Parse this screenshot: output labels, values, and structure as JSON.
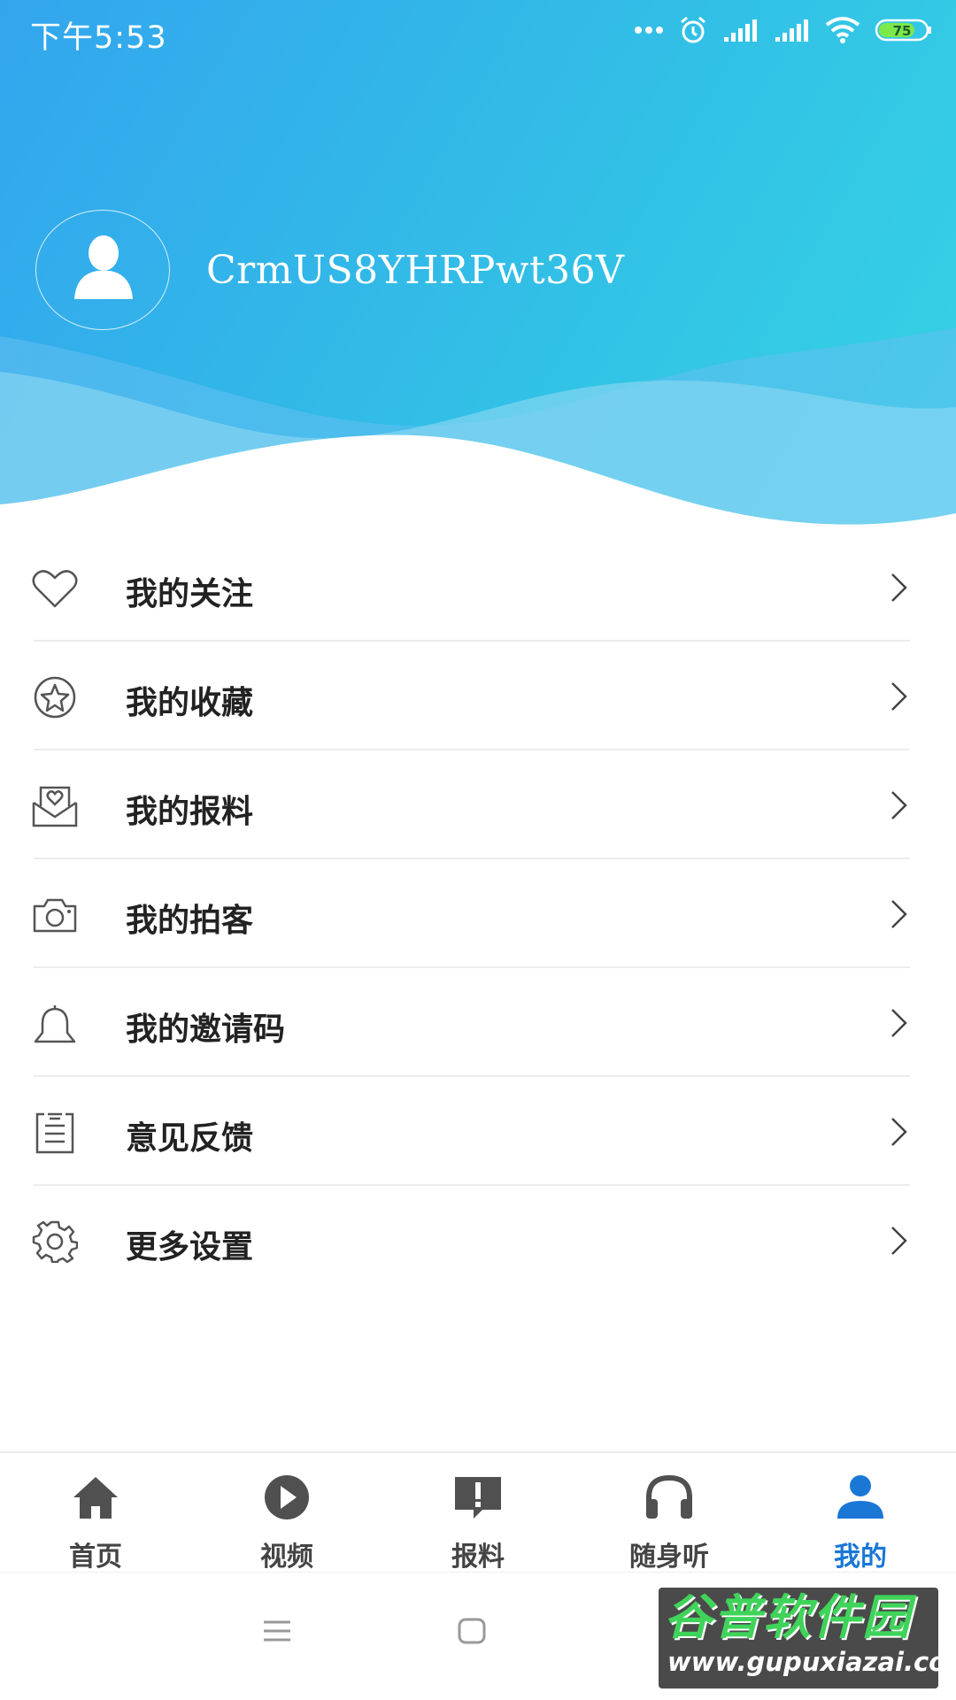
{
  "status_bar": {
    "time": "下午5:53",
    "battery": "75",
    "icons": [
      "more-dots-icon",
      "alarm-icon",
      "signal-icon",
      "signal-icon",
      "wifi-icon",
      "battery-icon"
    ]
  },
  "profile": {
    "username": "CrmUS8YHRPwt36V",
    "avatar_icon": "person-icon"
  },
  "menu": [
    {
      "label": "我的关注",
      "icon": "heart-icon"
    },
    {
      "label": "我的收藏",
      "icon": "star-icon"
    },
    {
      "label": "我的报料",
      "icon": "mail-heart-icon"
    },
    {
      "label": "我的拍客",
      "icon": "camera-icon"
    },
    {
      "label": "我的邀请码",
      "icon": "bell-icon"
    },
    {
      "label": "意见反馈",
      "icon": "clipboard-icon"
    },
    {
      "label": "更多设置",
      "icon": "gear-icon"
    }
  ],
  "tabs": [
    {
      "label": "首页",
      "icon": "home-icon",
      "active": false
    },
    {
      "label": "视频",
      "icon": "play-icon",
      "active": false
    },
    {
      "label": "报料",
      "icon": "alert-bubble-icon",
      "active": false
    },
    {
      "label": "随身听",
      "icon": "headphones-icon",
      "active": false
    },
    {
      "label": "我的",
      "icon": "user-icon",
      "active": true
    }
  ],
  "watermark": {
    "title": "谷普软件园",
    "url": "www.gupuxiazai.com"
  },
  "colors": {
    "header_start": "#33a5ee",
    "header_end": "#35d4e4",
    "active_tab": "#1a77d6",
    "text": "#222222"
  }
}
